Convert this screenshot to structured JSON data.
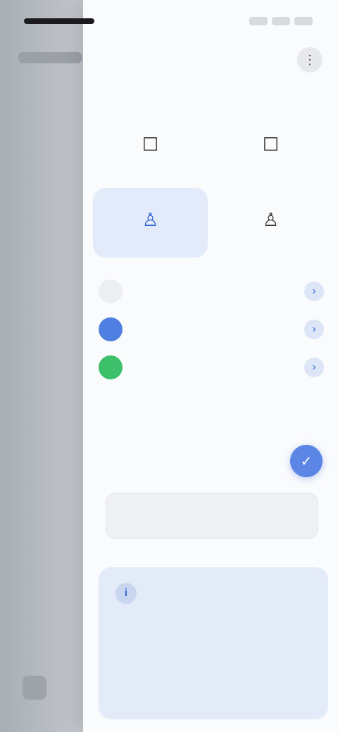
{
  "status_bar": {
    "time": "",
    "icons": [
      "signal-icon",
      "wifi-icon",
      "battery-icon"
    ]
  },
  "drawer": {
    "title": "",
    "menu_icon": "more-icon",
    "section_label": "",
    "actions": [
      {
        "label": "",
        "icon": "bookmark-icon",
        "selected": false
      },
      {
        "label": "",
        "icon": "folder-icon",
        "selected": false
      },
      {
        "label": "",
        "icon": "person-icon",
        "selected": true
      },
      {
        "label": "",
        "icon": "person-icon",
        "selected": false
      }
    ],
    "list": [
      {
        "label": "",
        "avatar_color": "#e8ebf0"
      },
      {
        "label": "",
        "avatar_color": "#4f7fe0"
      },
      {
        "label": "",
        "avatar_color": "#3cc06a"
      }
    ],
    "sub_heading": "",
    "toggle": {
      "label": "",
      "icon": "check-icon"
    },
    "text_field": {
      "value": ""
    },
    "info": {
      "body": "",
      "link": ""
    }
  },
  "colors": {
    "accent": "#3d6fe0",
    "selected_bg": "#e3ebfa",
    "info_bg": "#e3ebf8"
  }
}
